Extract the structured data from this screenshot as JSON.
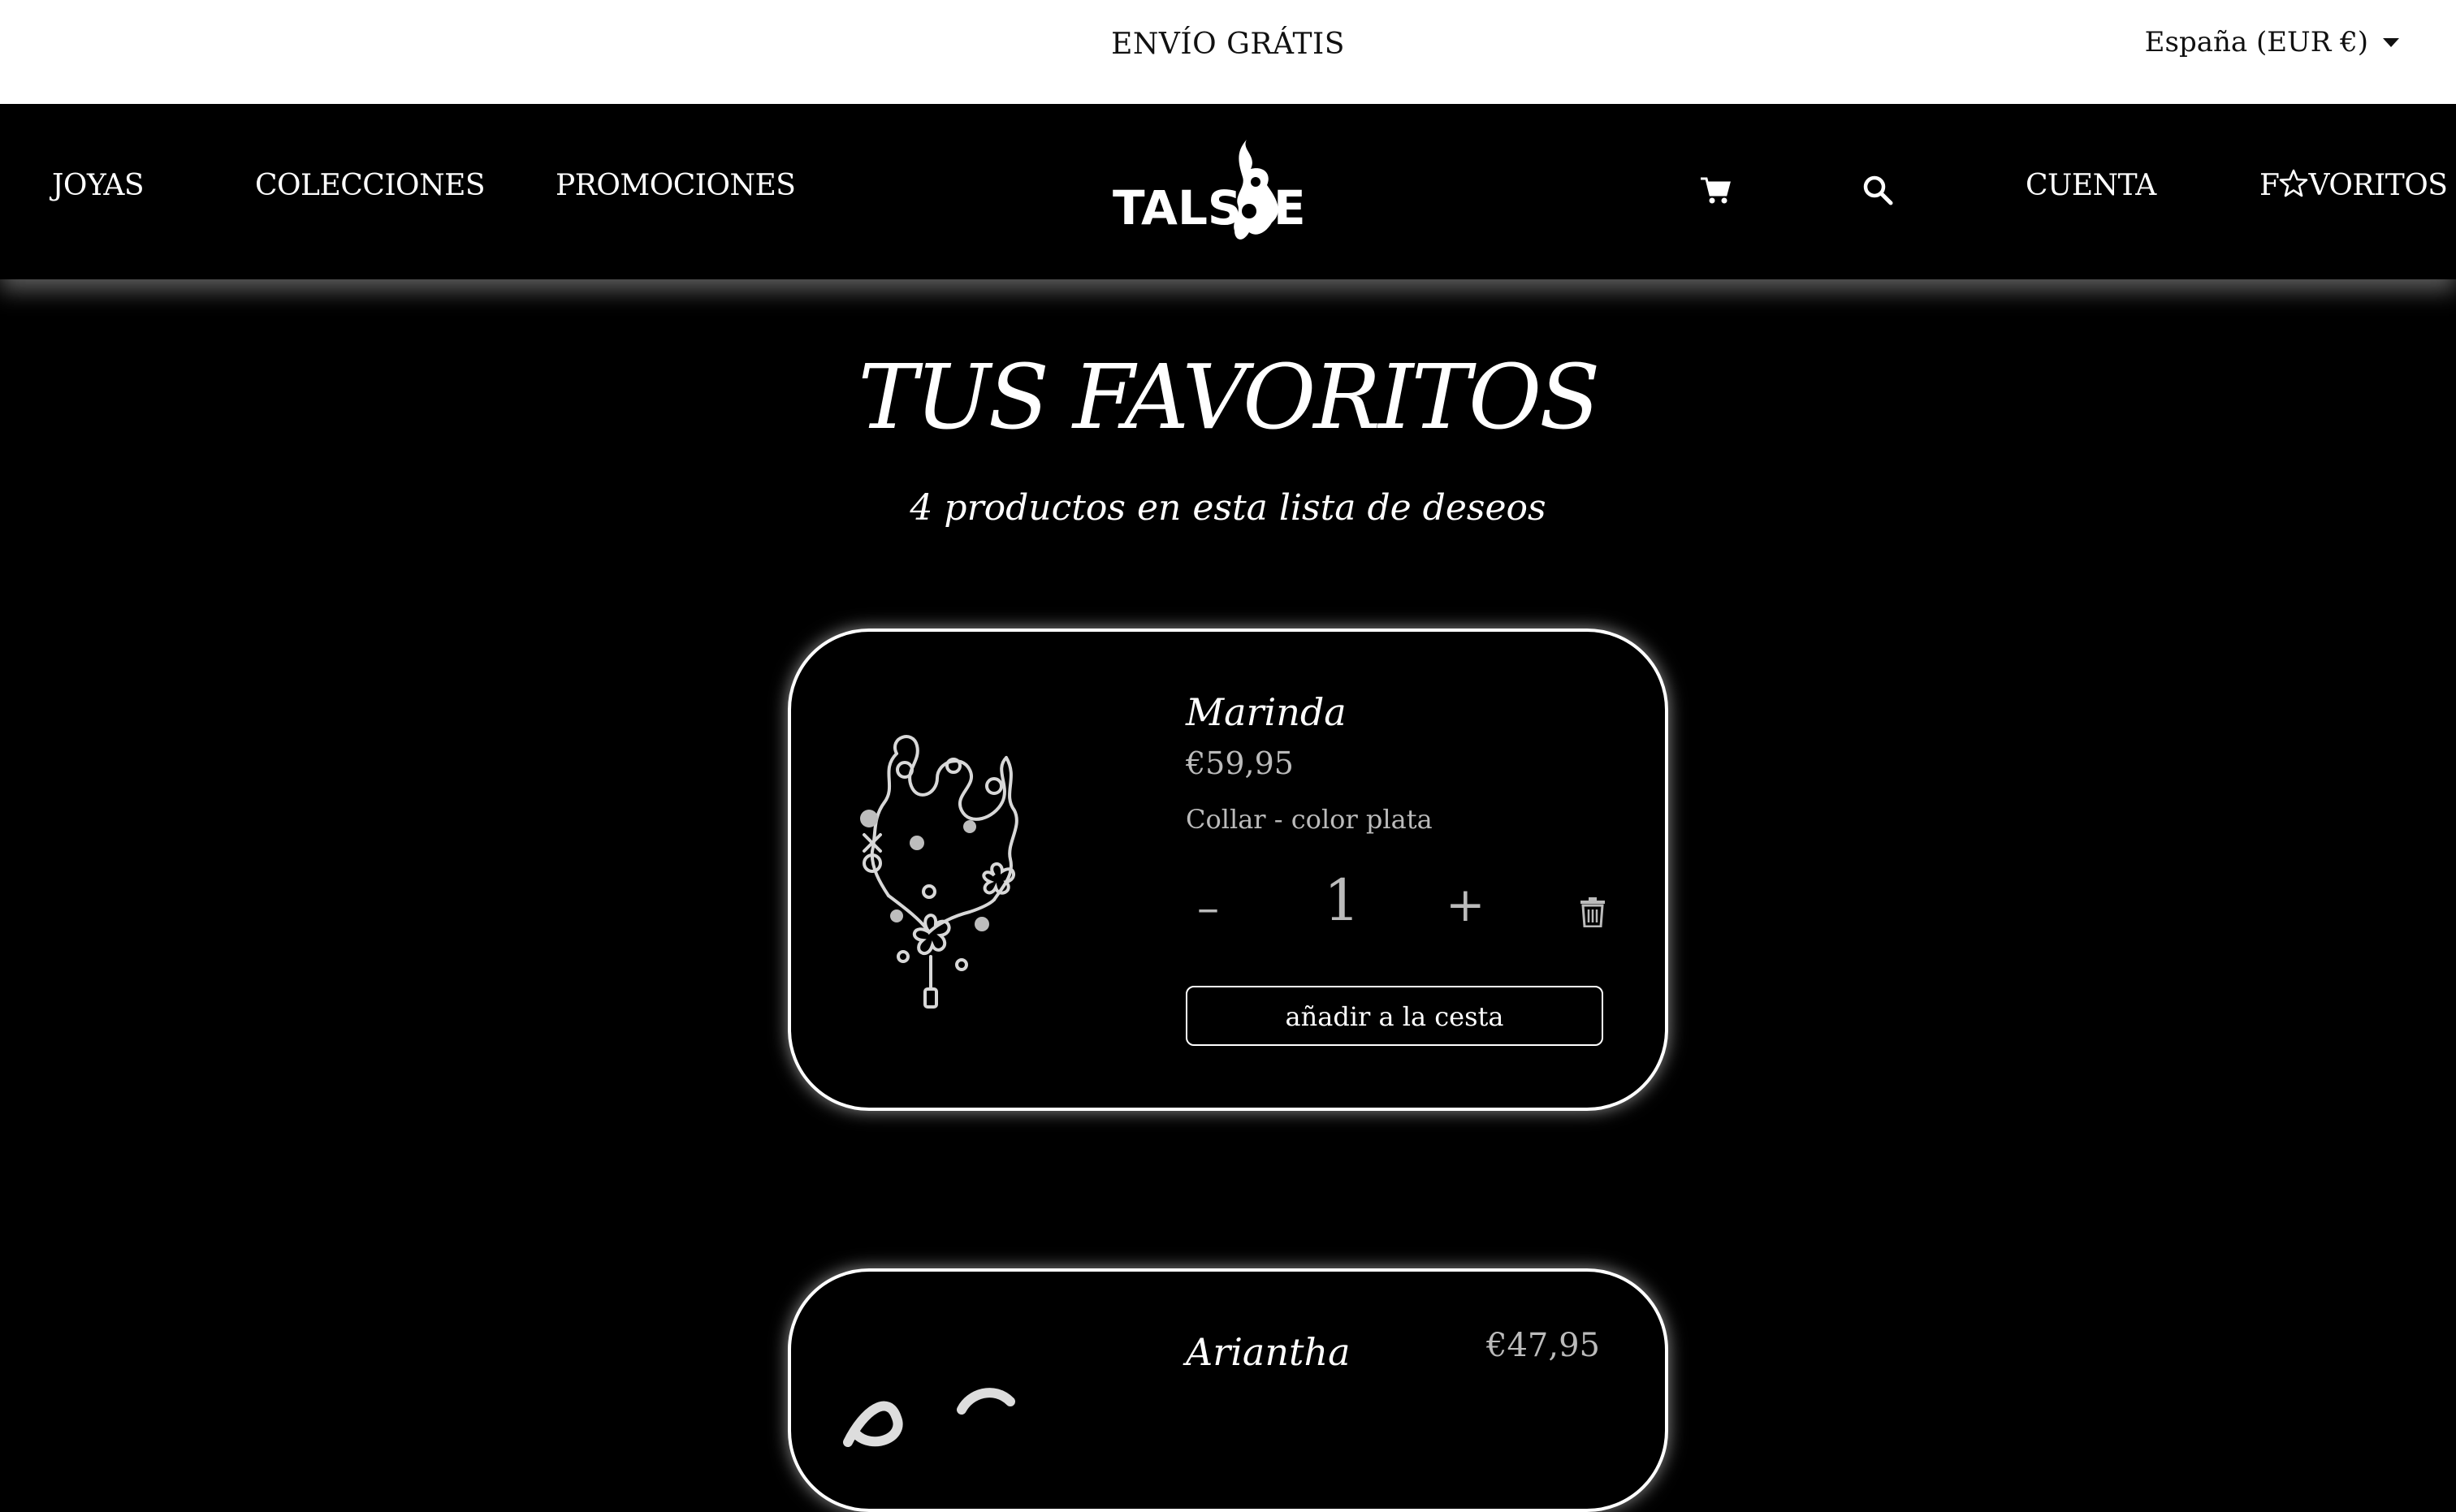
{
  "topbar": {
    "promo": "ENVÍO GRÁTIS",
    "region": "España (EUR €)"
  },
  "nav": {
    "left": [
      "JOYAS",
      "COLECCIONES",
      "PROMOCIONES"
    ],
    "logo_text": "TALSIE",
    "account": "CUENTA",
    "favorites_prefix": "F",
    "favorites_suffix": "VORITOS",
    "icons": [
      "cart-icon",
      "search-icon",
      "star-icon"
    ]
  },
  "page": {
    "title": "TUS FAVORITOS",
    "subtitle": "4 productos en esta lista de deseos"
  },
  "products": [
    {
      "name": "Marinda",
      "price": "€59,95",
      "description": "Collar - color plata",
      "quantity": "1",
      "minus": "–",
      "plus": "+",
      "add_to_cart": "añadir a la cesta"
    },
    {
      "name": "Ariantha",
      "price": "€47,95"
    }
  ]
}
